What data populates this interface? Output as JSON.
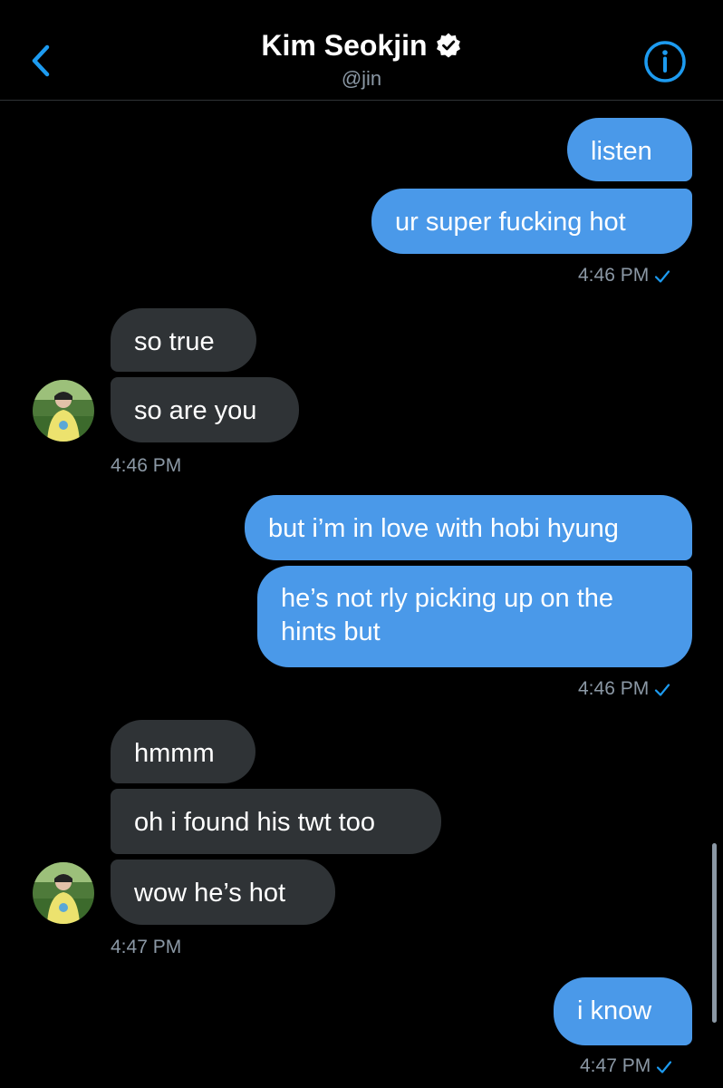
{
  "header": {
    "name": "Kim Seokjin",
    "handle": "@jin"
  },
  "messages": {
    "m1": "listen",
    "m2": "ur super fucking hot",
    "t1": "4:46 PM",
    "m3": "so true",
    "m4": "so are you",
    "t2": "4:46 PM",
    "m5": "but i’m in love with hobi hyung",
    "m6": "he’s not rly picking up on the hints but",
    "t3": "4:46 PM",
    "m7": "hmmm",
    "m8": "oh i found his twt too",
    "m9": "wow he’s hot",
    "t4": "4:47 PM",
    "m10": "i know",
    "t5": "4:47 PM"
  },
  "colors": {
    "accent": "#1d9bf0",
    "outgoing_bubble": "#4a99e9",
    "incoming_bubble": "#2f3336"
  },
  "icons": {
    "back": "chevron-left-icon",
    "verified": "verified-badge-icon",
    "info": "info-icon",
    "read": "checkmark-icon"
  }
}
